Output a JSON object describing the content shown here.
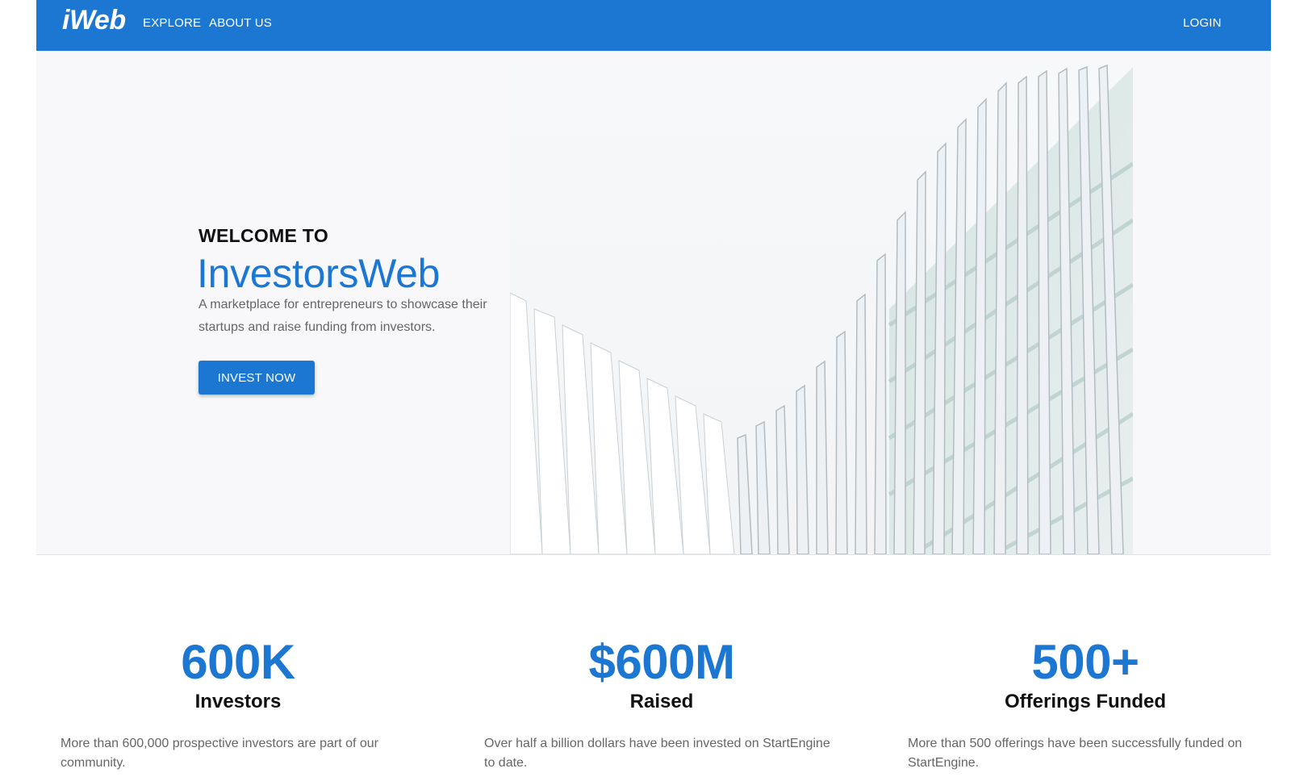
{
  "navbar": {
    "brand": "iWeb",
    "links": [
      "EXPLORE",
      "ABOUT US"
    ],
    "login": "LOGIN",
    "color": "#1c77d3"
  },
  "hero": {
    "kicker": "WELCOME TO",
    "title": "InvestorsWeb",
    "description": "A marketplace for entrepreneurs to showcase their startups and raise funding from investors.",
    "cta": "INVEST NOW",
    "image": "modern-architecture-photo"
  },
  "stats": [
    {
      "value": "600K",
      "label": "Investors",
      "description": "More than 600,000 prospective investors are part of our community."
    },
    {
      "value": "$600M",
      "label": "Raised",
      "description": "Over half a billion dollars have been invested on StartEngine to date."
    },
    {
      "value": "500+",
      "label": "Offerings Funded",
      "description": "More than 500 offerings have been successfully funded on StartEngine."
    }
  ]
}
